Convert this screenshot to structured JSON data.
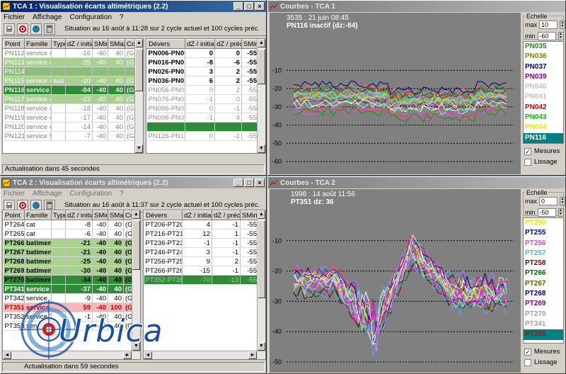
{
  "colors": {
    "row_green_light": "#a9d18e",
    "row_green_mid": "#8cc07a",
    "row_green_dark": "#2e8b36",
    "row_pink": "#f4b8b8",
    "selection_teal": "#008080",
    "chart_bg": "#808080",
    "logo_blue": "#1a4fa0"
  },
  "tca1": {
    "title": "TCA 1 : Visualisation écarts altimétriques (2.2)",
    "menu": [
      "Fichier",
      "Affichage",
      "Configuration",
      "?"
    ],
    "toolbar_icons": [
      "printer-icon",
      "target-icon",
      "globe-icon",
      "calculator-icon"
    ],
    "situation": "Situation au 16 août à 11:28 sur 2 cycle actuel et 100 cycles préc.",
    "points_headers": [
      "Point",
      "Famille",
      "Type",
      "dZ / initial",
      "SMin",
      "SMax",
      "Co"
    ],
    "points": [
      [
        "PN112",
        "service 4",
        "",
        "-16",
        "-40",
        "40",
        "(Gra"
      ],
      [
        "PN113",
        "service 4",
        "",
        "-25",
        "-40",
        "40",
        "(Gra"
      ],
      [
        "PN114",
        "",
        "",
        "",
        "",
        "",
        ""
      ],
      [
        "PN115",
        "service 4",
        "aus",
        "-20",
        "-40",
        "40",
        "(Gra"
      ],
      [
        "PN116",
        "service dave",
        "",
        "-84",
        "-40",
        "40",
        "(Gr"
      ],
      [
        "PN117",
        "service 4",
        "",
        "-22",
        "-40",
        "40",
        "(Gra"
      ],
      [
        "PN118",
        "service 4",
        "",
        "-18",
        "-40",
        "40",
        "(Gra"
      ],
      [
        "PN119",
        "service 4",
        "",
        "-17",
        "-40",
        "40",
        "(Gra"
      ],
      [
        "PN120",
        "service 4",
        "",
        "-14",
        "-40",
        "40",
        "(Gra"
      ],
      [
        "PN121",
        "service 5",
        "",
        "-7",
        "-40",
        "40",
        "(Gra"
      ]
    ],
    "devers_headers": [
      "Dévers",
      "dZ / initial",
      "dZ / préc",
      "SMin"
    ],
    "devers": [
      [
        "PN006-PN005",
        "0",
        "0",
        "-55"
      ],
      [
        "PN016-PN015",
        "-8",
        "-6",
        "-55"
      ],
      [
        "PN026-PN025",
        "3",
        "2",
        "-55"
      ],
      [
        "PN036-PN035",
        "6",
        "2",
        "-55"
      ],
      [
        "PN056-PN055",
        "0",
        "2",
        "-55"
      ],
      [
        "PN076-PN075",
        "-1",
        "0",
        "-55"
      ],
      [
        "PN086-PN085",
        "0",
        "-1",
        "-55"
      ],
      [
        "PN096-PN095",
        "-1",
        "4",
        "-55"
      ],
      [
        "",
        "",
        "",
        ""
      ],
      [
        "PN126-PN125",
        "0",
        "-1",
        "-55"
      ]
    ],
    "status": "Actualisation dans 45 secondes"
  },
  "courbes1": {
    "title": "Courbes - TCA 1",
    "header_line1": "3535 : 21 juin 08:45",
    "header_line2": "PN116 inactif (dz:-84)",
    "yticks": [
      "-10",
      "-20",
      "-30",
      "-40",
      "-50",
      "-60"
    ],
    "echelle_label": "Echelle",
    "max_label": "max",
    "max_value": "10",
    "min_label": "min",
    "min_value": "-60",
    "legend": [
      {
        "name": "PN035",
        "color": "#2e7d2e"
      },
      {
        "name": "PN036",
        "color": "#808000"
      },
      {
        "name": "PN037",
        "color": "#000080"
      },
      {
        "name": "PN039",
        "color": "#800080"
      },
      {
        "name": "PN040",
        "color": "#c0c0c0"
      },
      {
        "name": "PN041",
        "color": "#c0c0c0"
      },
      {
        "name": "PN042",
        "color": "#cc0000"
      },
      {
        "name": "PN043",
        "color": "#00c000"
      },
      {
        "name": "PN044",
        "color": "#e8e800"
      },
      {
        "name": "PN116",
        "color": "#0000a0"
      }
    ],
    "mesures_label": "Mesures",
    "mesures_checked": "✓",
    "lissage_label": "Lissage",
    "chart_data": {
      "type": "line",
      "ylim": [
        -60,
        10
      ],
      "yticks": [
        -10,
        -20,
        -30,
        -40,
        -50,
        -60
      ],
      "grid": true
    }
  },
  "tca2": {
    "title": "TCA 2 : Visualisation écarts altimétriques (2.2)",
    "menu": [
      "Fichier",
      "Affichage",
      "Configuration",
      "?"
    ],
    "situation": "Situation au 16 août à 11:37 sur 2 cycle actuel et 100 cycles préc.",
    "points_headers": [
      "Point",
      "Famille",
      "Type",
      "dZ / initial",
      "SMin",
      "SMax",
      "Co"
    ],
    "points": [
      [
        "PT264",
        "cat",
        "",
        "-8",
        "-40",
        "40",
        "(Gr"
      ],
      [
        "PT265",
        "cat",
        "",
        "-6",
        "-40",
        "40",
        "(Gr"
      ],
      [
        "PT266",
        "batiment",
        "",
        "-21",
        "-40",
        "40",
        "(Gr"
      ],
      [
        "PT267",
        "batiment",
        "",
        "-21",
        "-40",
        "40",
        "(Gr"
      ],
      [
        "PT268",
        "batiment",
        "",
        "-25",
        "-40",
        "40",
        "(Gr"
      ],
      [
        "PT269",
        "batiment",
        "",
        "-30",
        "-40",
        "40",
        "(Gr"
      ],
      [
        "PT270",
        "batiment",
        "",
        "-34",
        "-40",
        "40",
        "(Gr"
      ],
      [
        "PT341",
        "service",
        "",
        "-37",
        "-40",
        "40",
        "(Gr"
      ],
      [
        "PT342",
        "service",
        "",
        "-9",
        "-40",
        "40",
        "(Gr"
      ],
      [
        "PT351",
        "service",
        "",
        "59",
        "-40",
        "100",
        "(Gr"
      ],
      [
        "PT352",
        "service 7",
        "",
        "-1",
        "-40",
        "40",
        "(Gr"
      ],
      [
        "PT353",
        "service 7",
        "",
        "-1",
        "-40",
        "40",
        "(Gr"
      ]
    ],
    "devers_headers": [
      "Dévers",
      "dZ / initial",
      "dZ / préc",
      "SMin"
    ],
    "devers": [
      [
        "PT206-PT205",
        "4",
        "-1",
        "-55"
      ],
      [
        "PT216-PT215",
        "12",
        "1",
        "-55"
      ],
      [
        "PT236-PT235",
        "-1",
        "-1",
        "-55"
      ],
      [
        "PT246-PT245",
        "3",
        "-1",
        "-55"
      ],
      [
        "PT256-PT255",
        "9",
        "2",
        "-55"
      ],
      [
        "PT266-PT265",
        "-15",
        "-1",
        "-55"
      ],
      [
        "PT352-PT351",
        "-70",
        "-13",
        "-55"
      ]
    ],
    "status": "Actualisation dans 59 secondes"
  },
  "courbes2": {
    "title": "Courbes - TCA 2",
    "header_line1": "1998 : 14 août 11:56",
    "header_line2": "PT351 dz: 36",
    "yticks": [
      "-10",
      "-20",
      "-30",
      "-40",
      "-50"
    ],
    "echelle_label": "Echelle",
    "max_label": "max",
    "max_value": "0",
    "min_label": "min",
    "min_value": "-50",
    "legend": [
      {
        "name": "PT250",
        "color": "#e8e800"
      },
      {
        "name": "PT255",
        "color": "#000080"
      },
      {
        "name": "PT256",
        "color": "#e040e0"
      },
      {
        "name": "PT257",
        "color": "#40c0c0"
      },
      {
        "name": "PT258",
        "color": "#800000"
      },
      {
        "name": "PT266",
        "color": "#006000"
      },
      {
        "name": "PT267",
        "color": "#606000"
      },
      {
        "name": "PT268",
        "color": "#000060"
      },
      {
        "name": "PT269",
        "color": "#800080"
      },
      {
        "name": "PT270",
        "color": "#a0a0a0"
      },
      {
        "name": "PT341",
        "color": "#a0a0a0"
      },
      {
        "name": "PT351",
        "color": "#cc0000"
      }
    ],
    "mesures_label": "Mesures",
    "mesures_checked": "✓",
    "lissage_label": "Lissage",
    "chart_data": {
      "type": "line",
      "ylim": [
        -50,
        0
      ],
      "yticks": [
        -10,
        -20,
        -30,
        -40,
        -50
      ],
      "grid": true
    }
  },
  "logo": {
    "text": "Urbica"
  }
}
